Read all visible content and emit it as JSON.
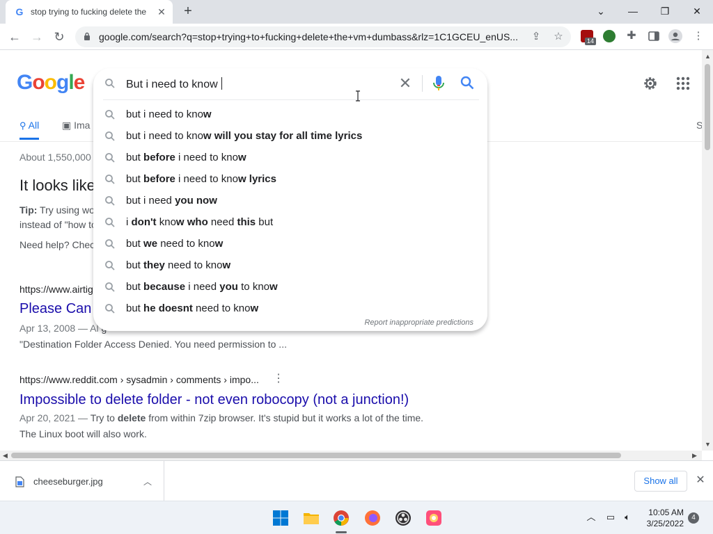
{
  "browser": {
    "tab_title": "stop trying to fucking delete the",
    "url": "google.com/search?q=stop+trying+to+fucking+delete+the+vm+dumbass&rlz=1C1GCEU_enUS...",
    "extension_badge": "14"
  },
  "search": {
    "query": "But i need to know ",
    "tabs": [
      "All",
      "Ima",
      "S"
    ],
    "stats": "About 1,550,000",
    "suggestions": [
      {
        "pre": "but i need to kno",
        "bold": "w",
        "post": ""
      },
      {
        "pre": "but i need to kno",
        "bold": "w will you stay for all time lyrics",
        "post": ""
      },
      {
        "pre": "but ",
        "bold": "before",
        "post": " i need to kno",
        "bold2": "w",
        "post2": ""
      },
      {
        "pre": "but ",
        "bold": "before",
        "post": " i need to kno",
        "bold2": "w lyrics",
        "post2": ""
      },
      {
        "pre": "but i need ",
        "bold": "you now",
        "post": ""
      },
      {
        "pre": "i ",
        "bold": "don't",
        "post": " kno",
        "bold2": "w who",
        "post2": " need ",
        "bold3": "this",
        "post3": " but"
      },
      {
        "pre": "but ",
        "bold": "we",
        "post": " need to kno",
        "bold2": "w",
        "post2": ""
      },
      {
        "pre": "but ",
        "bold": "they",
        "post": " need to kno",
        "bold2": "w",
        "post2": ""
      },
      {
        "pre": "but ",
        "bold": "because",
        "post": " i need ",
        "bold2": "you",
        "post2": " to kno",
        "bold3": "w",
        "post3": ""
      },
      {
        "pre": "but ",
        "bold": "he doesnt",
        "post": " need to kno",
        "bold2": "w",
        "post2": ""
      }
    ],
    "report": "Report inappropriate predictions"
  },
  "results": {
    "looks_like": "It looks like",
    "tip_label": "Tip:",
    "tip_line1": " Try using wo",
    "tip_line2": "instead of \"how to",
    "need_help": "Need help? Chec",
    "r1_url": "https://www.airtig",
    "r1_title": "Please Can",
    "r1_snip1_date": "Apr 13, 2008 — Al",
    "r1_snip1_rest": "                                                                                  g",
    "r1_snip2": "\"Destination Folder Access Denied. You need permission to ...",
    "r2_url": "https://www.reddit.com › sysadmin › comments › impo...",
    "r2_title": "Impossible to delete folder - not even robocopy (not a junction!)",
    "r2_snip1_date": "Apr 20, 2021 — ",
    "r2_snip1_a": "Try to ",
    "r2_snip1_b": "delete",
    "r2_snip1_c": " from within 7zip browser. It's stupid but it works a lot of the time.",
    "r2_snip2": "The Linux boot will also work."
  },
  "downloads": {
    "file": "cheeseburger.jpg",
    "show_all": "Show all"
  },
  "taskbar": {
    "time": "10:05 AM",
    "date": "3/25/2022",
    "notifications": "4"
  },
  "colors": {
    "google_blue": "#4285f4",
    "google_red": "#ea4335",
    "google_yellow": "#fbbc05",
    "google_green": "#34a853",
    "link": "#1a0dab",
    "accent": "#1a73e8"
  },
  "icons": {
    "tab_favicon": "google-g-icon",
    "lock": "lock-icon",
    "share": "share-icon",
    "star": "star-icon",
    "extensions": "puzzle-icon",
    "sidepanel": "side-panel-icon",
    "profile": "profile-icon",
    "menu": "kebab-menu-icon",
    "settings": "gear-icon",
    "apps": "apps-grid-icon",
    "search": "magnifier-icon",
    "mic": "microphone-icon",
    "clear": "close-icon"
  }
}
